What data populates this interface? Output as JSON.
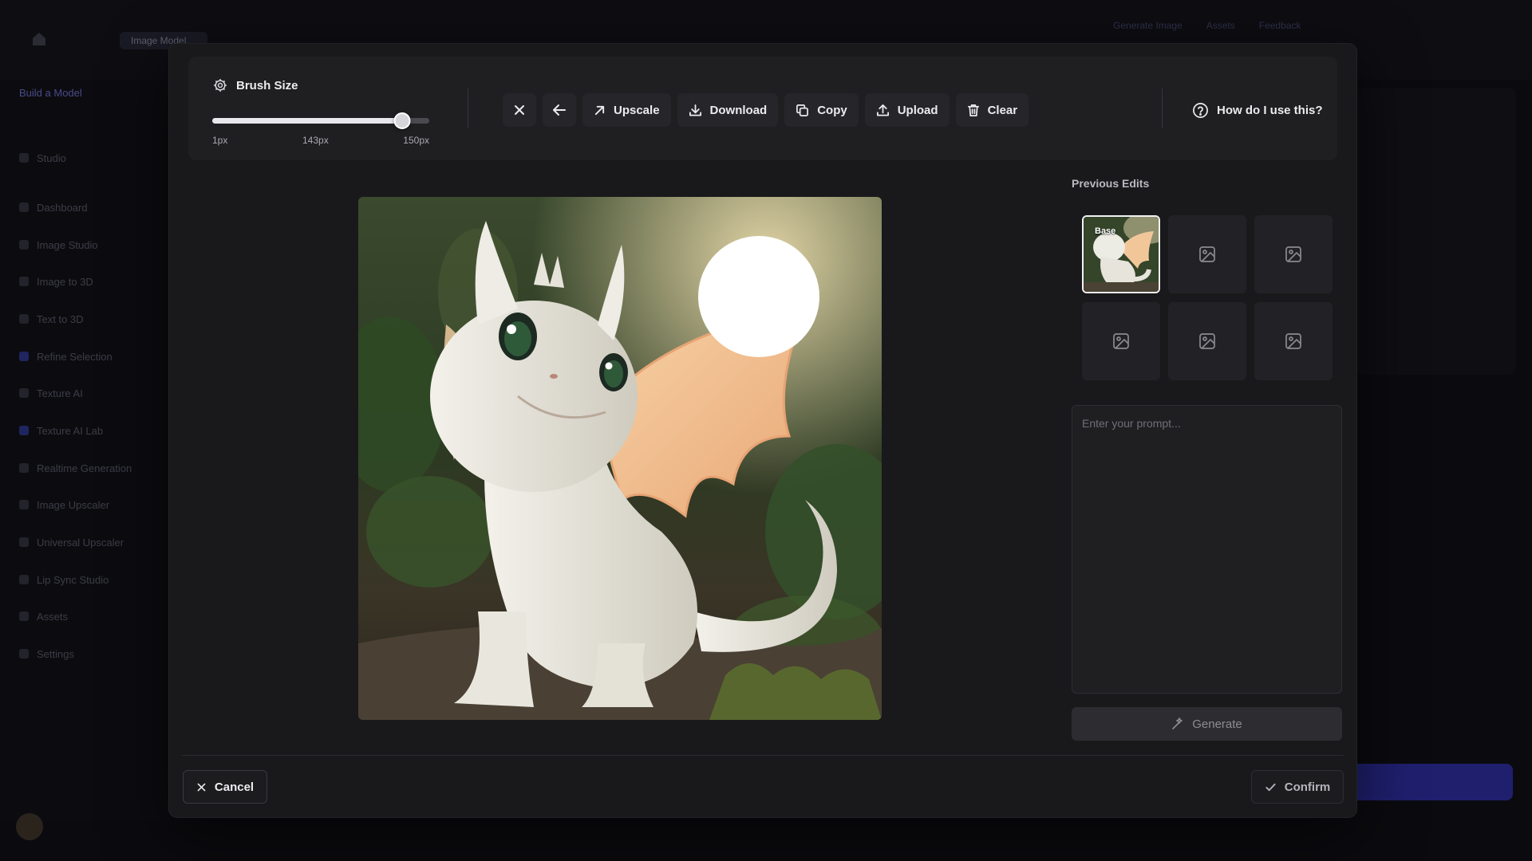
{
  "background_app": {
    "breadcrumb": "Image Model",
    "sidebar_title": "Build a Model",
    "sidebar_items": [
      "Studio",
      "Dashboard",
      "Image Studio",
      "Image to 3D",
      "Text to 3D",
      "Refine Selection",
      "Texture AI",
      "Texture AI Lab",
      "Realtime Generation",
      "Image Upscaler",
      "Universal Upscaler",
      "Lip Sync Studio",
      "Assets",
      "Settings"
    ],
    "top_right": [
      "Generate Image",
      "Assets",
      "Feedback"
    ]
  },
  "toolbar": {
    "brush_title": "Brush Size",
    "brush_min_label": "1px",
    "brush_current_label": "143px",
    "brush_max_label": "150px",
    "brush_min": 1,
    "brush_max": 150,
    "brush_value": 143,
    "close_icon": "close-icon",
    "undo_icon": "arrow-left-icon",
    "upscale_label": "Upscale",
    "download_label": "Download",
    "copy_label": "Copy",
    "upload_label": "Upload",
    "clear_label": "Clear",
    "help_label": "How do I use this?"
  },
  "previous_edits": {
    "title": "Previous Edits",
    "items": [
      {
        "type": "image",
        "badge": "Base",
        "selected": true
      },
      {
        "type": "placeholder",
        "icon": "image-placeholder-icon"
      },
      {
        "type": "placeholder",
        "icon": "image-placeholder-icon"
      },
      {
        "type": "placeholder",
        "icon": "image-placeholder-icon"
      },
      {
        "type": "placeholder",
        "icon": "image-placeholder-icon"
      },
      {
        "type": "placeholder",
        "icon": "image-placeholder-icon"
      }
    ]
  },
  "prompt": {
    "placeholder": "Enter your prompt...",
    "value": ""
  },
  "generate_label": "Generate",
  "footer": {
    "cancel_label": "Cancel",
    "confirm_label": "Confirm"
  },
  "canvas": {
    "subject": "white baby dragon with peach wings in a forest",
    "mask": "white circular brush mask over upper wing"
  },
  "colors": {
    "modal_bg": "#19191b",
    "toolbar_bg": "#1f1f22",
    "button_bg": "#26262a",
    "text": "#ececef",
    "muted": "#a9a9b0"
  }
}
